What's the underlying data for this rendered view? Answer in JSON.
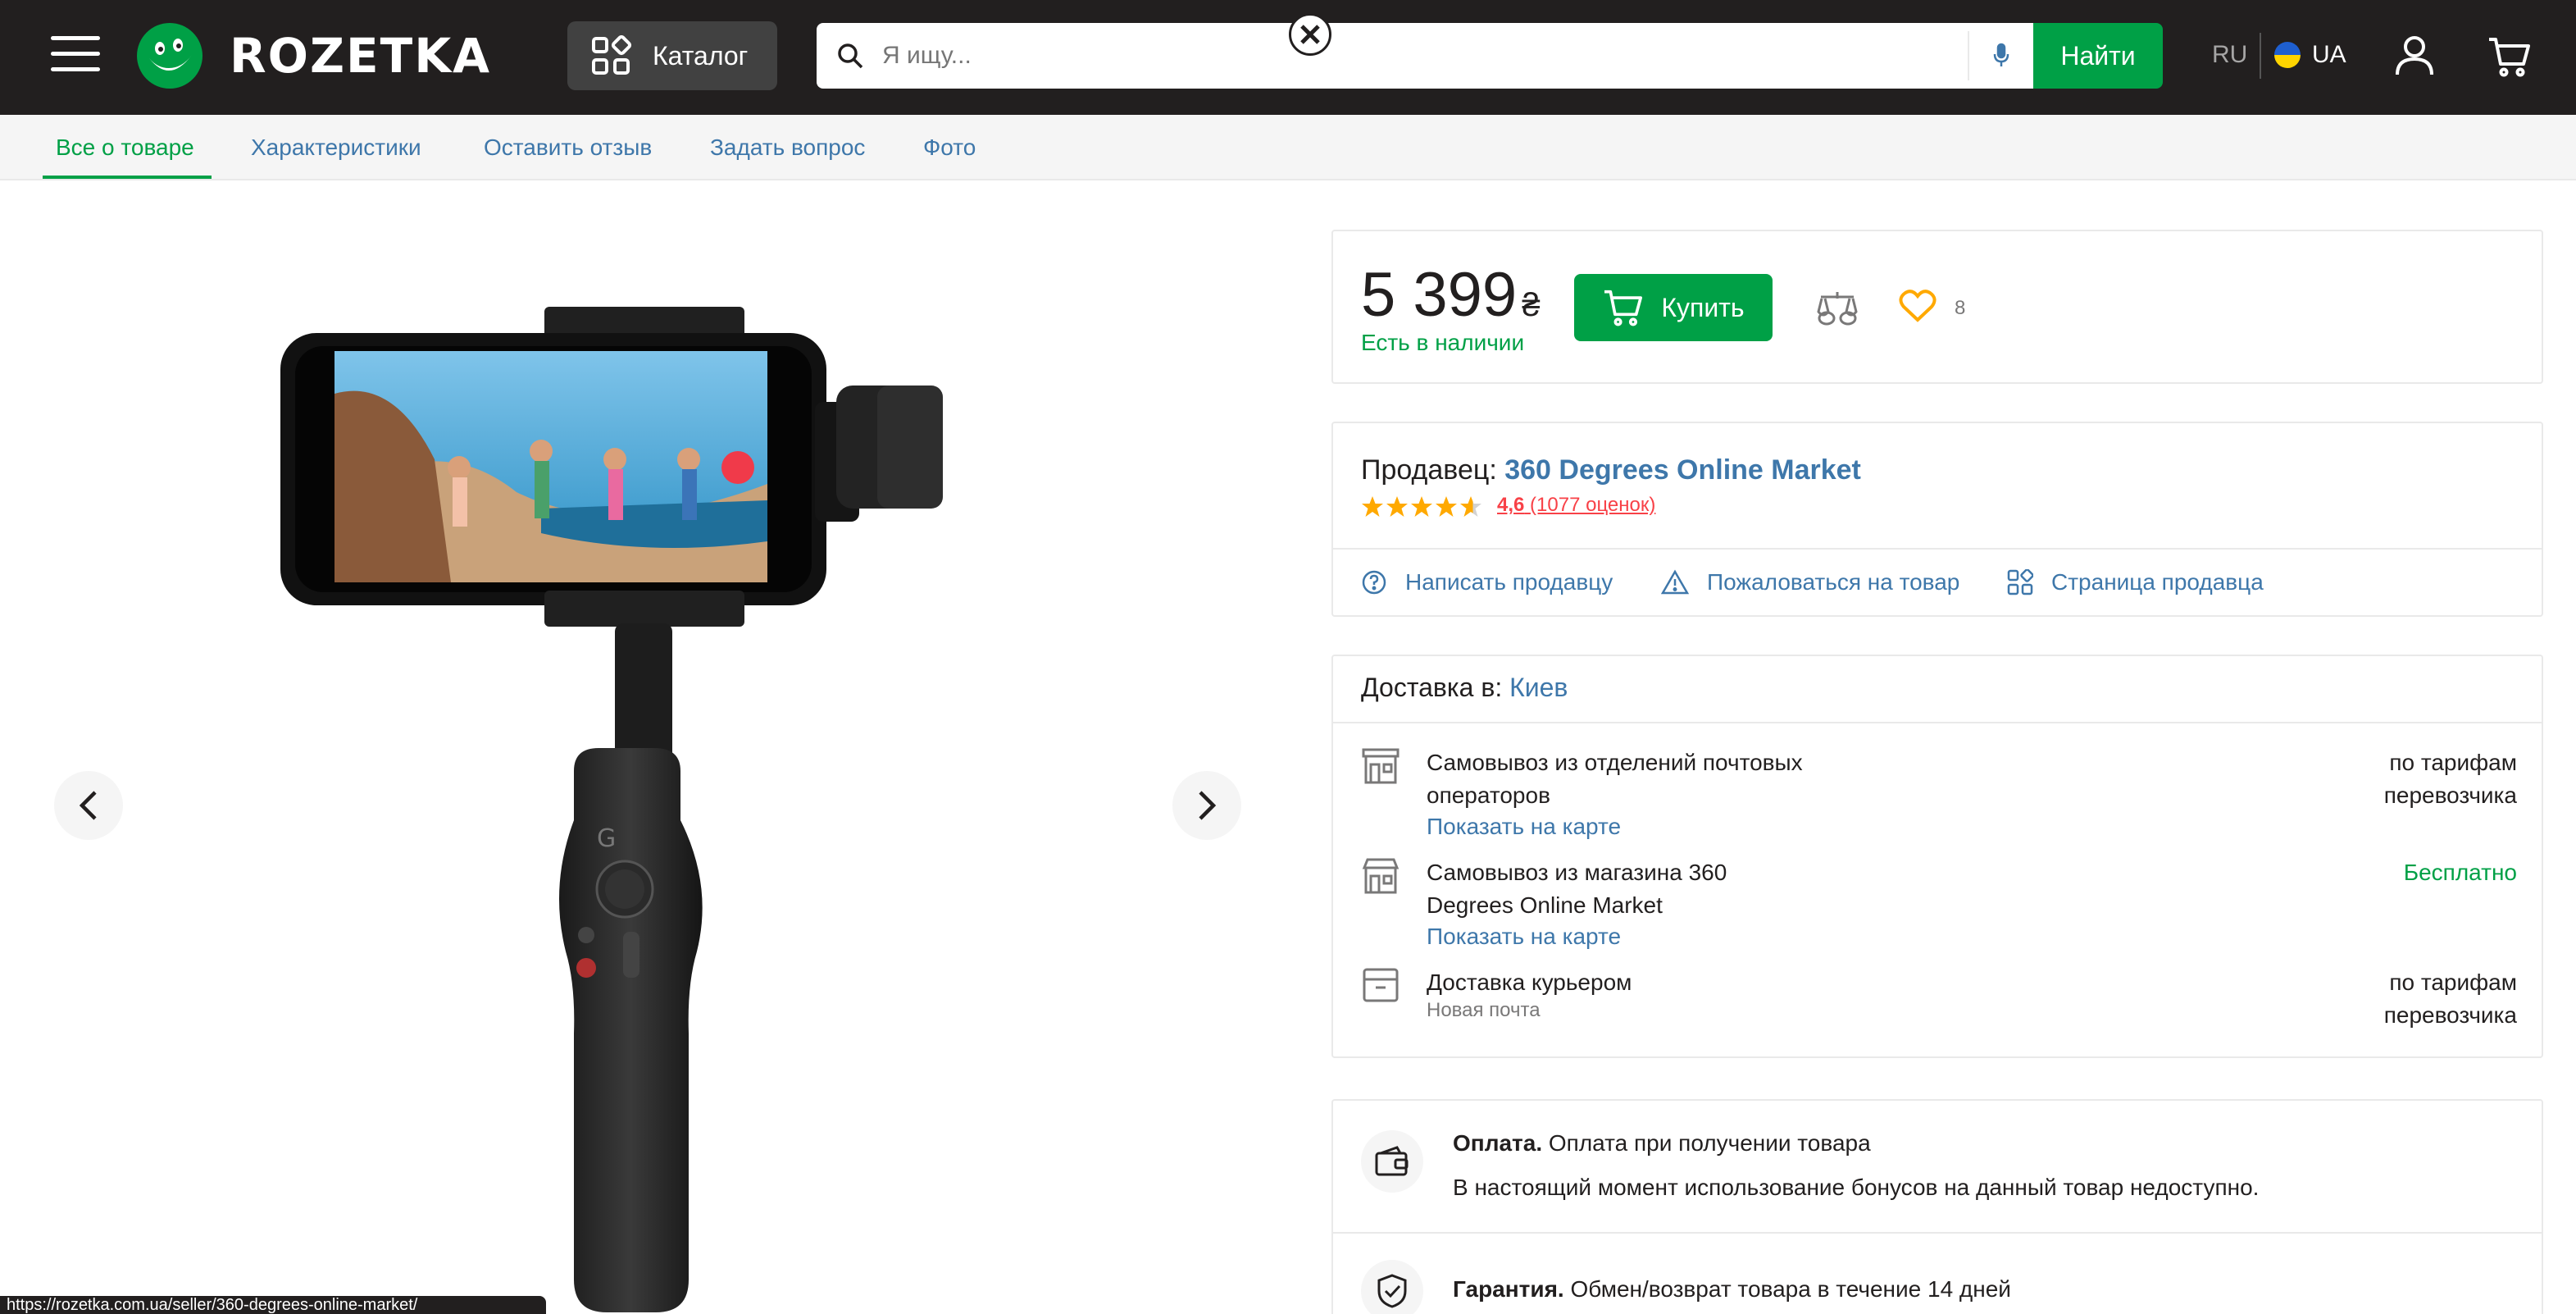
{
  "header": {
    "logo_text": "ROZETKA",
    "catalog_label": "Каталог",
    "search_placeholder": "Я ищу...",
    "search_button": "Найти",
    "lang_ru": "RU",
    "lang_ua": "UA"
  },
  "tabs": [
    {
      "label": "Все о товаре",
      "active": true
    },
    {
      "label": "Характеристики"
    },
    {
      "label": "Оставить отзыв"
    },
    {
      "label": "Задать вопрос"
    },
    {
      "label": "Фото"
    }
  ],
  "price_panel": {
    "price": "5 399",
    "currency": "₴",
    "availability": "Есть в наличии",
    "buy_label": "Купить",
    "wishlist_count": "8"
  },
  "seller": {
    "prefix": "Продавец:",
    "name": "360 Degrees Online Market",
    "rating": "4,6",
    "reviews": "(1077 оценок)",
    "rating_value": 4.6,
    "actions": [
      "Написать продавцу",
      "Пожаловаться на товар",
      "Страница продавца"
    ]
  },
  "delivery": {
    "title_prefix": "Доставка в:",
    "city": "Киев",
    "options": [
      {
        "name": "Самовывоз из отделений почтовых",
        "name2": "операторов",
        "link": "Показать на карте",
        "price": "по тарифам",
        "price2": "перевозчика"
      },
      {
        "name": "Самовывоз из магазина 360",
        "name2": "Degrees Online Market",
        "link": "Показать на карте",
        "price": "Бесплатно"
      },
      {
        "name": "Доставка курьером",
        "sub": "Новая почта",
        "price": "по тарифам",
        "price2": "перевозчика"
      }
    ]
  },
  "payment": {
    "label": "Оплата.",
    "text": "Оплата при получении товара",
    "note": "В настоящий момент использование бонусов на данный товар недоступно."
  },
  "warranty": {
    "label": "Гарантия.",
    "text": "Обмен/возврат товара в течение 14 дней"
  },
  "status_bar_url": "https://rozetka.com.ua/seller/360-degrees-online-market/",
  "colors": {
    "header_bg": "#221f1f",
    "accent_green": "#00a046",
    "link_blue": "#3e77aa",
    "star_orange": "#ffa900",
    "rating_red": "#f84147"
  }
}
